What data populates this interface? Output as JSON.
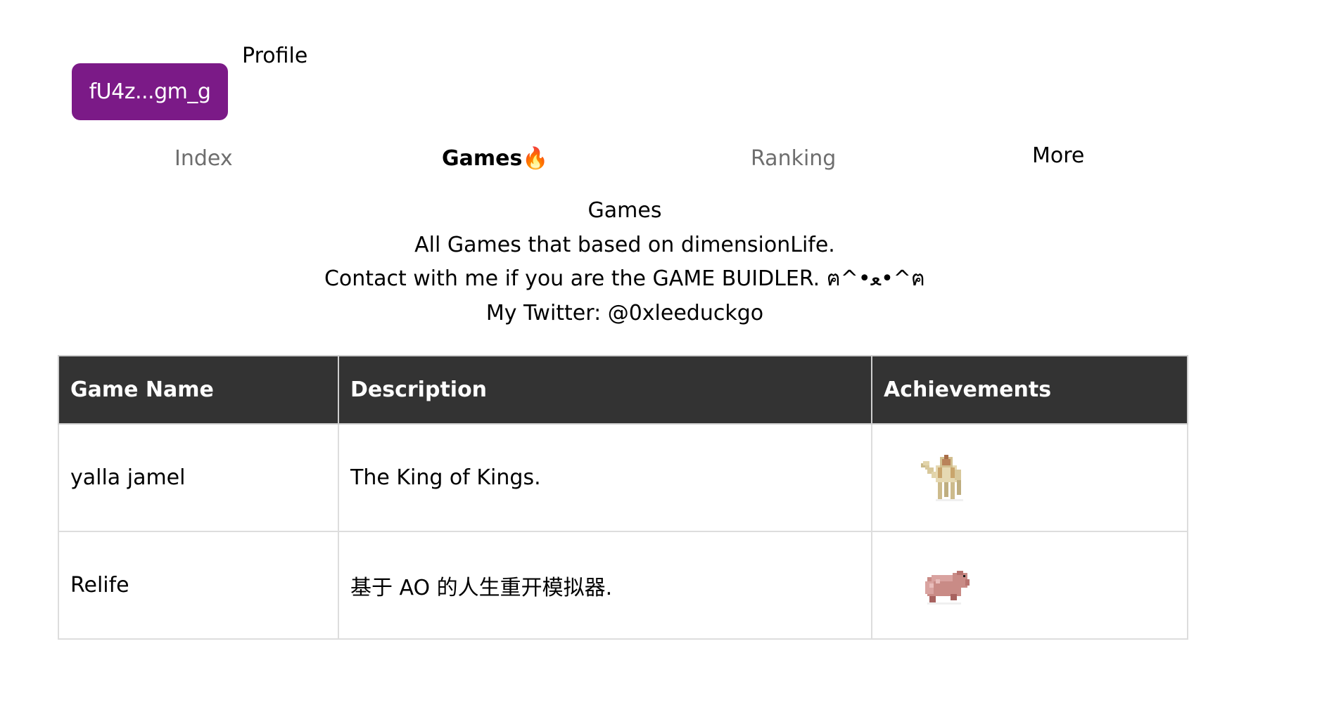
{
  "header": {
    "wallet_label": "fU4z...gm_g",
    "profile_label": "Profile"
  },
  "nav": {
    "index": "Index",
    "games": "Games🔥",
    "ranking": "Ranking",
    "more": "More"
  },
  "intro": {
    "title": "Games",
    "line1": "All Games that based on dimensionLife.",
    "line2": "Contact with me if you are the GAME BUIDLER. ฅ^•ﻌ•^ฅ",
    "line3": "My Twitter: @0xleeduckgo"
  },
  "table": {
    "headers": {
      "name": "Game Name",
      "description": "Description",
      "achievements": "Achievements"
    },
    "rows": [
      {
        "name": "yalla jamel",
        "description": "The King of Kings.",
        "achievement_icon": "camel-icon"
      },
      {
        "name": "Relife",
        "description": "基于 AO 的人生重开模拟器.",
        "achievement_icon": "capybara-icon"
      }
    ]
  },
  "colors": {
    "wallet_button": "#7b1a87",
    "table_header_bg": "#333333",
    "nav_inactive": "#6e6e6e"
  }
}
